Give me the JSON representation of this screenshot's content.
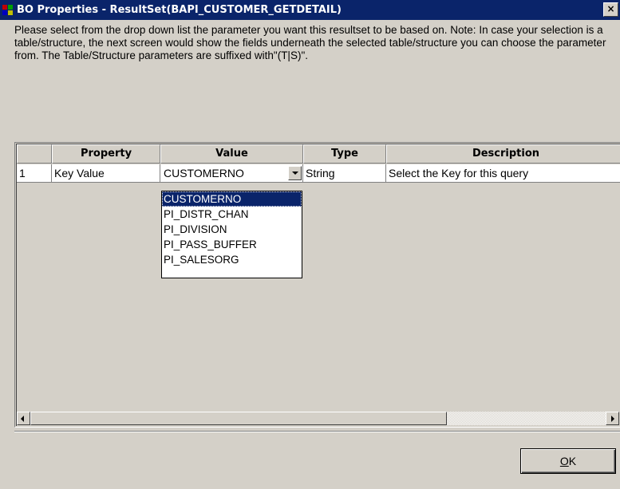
{
  "window": {
    "title": "BO Properties - ResultSet(BAPI_CUSTOMER_GETDETAIL)",
    "close_glyph": "×"
  },
  "instructions": "Please select from the drop down list the parameter you want this resultset to be based on. Note: In case your selection is a table/structure, the next screen would show the fields underneath the selected table/structure you can choose the parameter from. The Table/Structure parameters are suffixed with\"(T|S)\".",
  "grid": {
    "columns": [
      "Property",
      "Value",
      "Type",
      "Description"
    ],
    "rows": [
      {
        "num": "1",
        "property": "Key Value",
        "value": "CUSTOMERNO",
        "type": "String",
        "description": "Select the Key for this query"
      }
    ]
  },
  "dropdown": {
    "options": [
      "CUSTOMERNO",
      "PI_DISTR_CHAN",
      "PI_DIVISION",
      "PI_PASS_BUFFER",
      "PI_SALESORG"
    ],
    "selected": "CUSTOMERNO"
  },
  "ok_button": {
    "accel": "O",
    "rest": "K"
  },
  "colors": {
    "titlebar": "#0a246a",
    "face": "#d4d0c8",
    "selection": "#0a246a"
  },
  "icons": {
    "app": "app-icon",
    "dropdown": "chevron-down-icon",
    "scroll_left": "arrow-left-icon",
    "scroll_right": "arrow-right-icon"
  }
}
